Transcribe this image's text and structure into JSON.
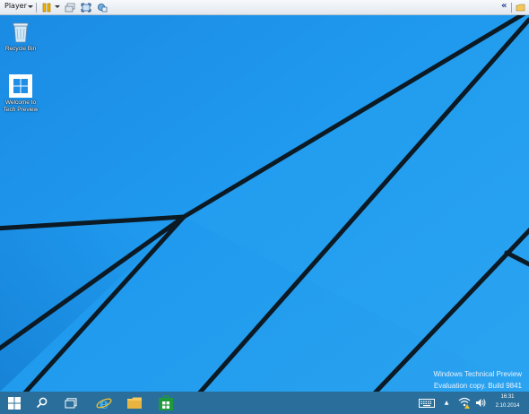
{
  "player": {
    "menu_label": "Player",
    "collapse_glyph": "«"
  },
  "desktop": {
    "icons": [
      {
        "label_line1": "Recycle Bin",
        "label_line2": "",
        "icon": "recycle-bin-icon"
      },
      {
        "label_line1": "Welcome to",
        "label_line2": "Tech Preview",
        "icon": "windows-logo-icon"
      }
    ],
    "watermark": {
      "line1": "Windows Technical Preview",
      "line2": "Evaluation copy. Build 9841"
    }
  },
  "taskbar": {
    "buttons": [
      "start-button",
      "search-button",
      "task-view-button",
      "internet-explorer-button",
      "file-explorer-button",
      "store-button"
    ],
    "tray": {
      "time": "16:31",
      "date": "2.10.2014",
      "show_hidden_glyph": "▲"
    }
  },
  "colors": {
    "wallpaper": "#1e8fe8",
    "wallpaper_light": "#2aa6f2",
    "taskbar": "#2a6f9b",
    "lines": "#0b1a24"
  }
}
